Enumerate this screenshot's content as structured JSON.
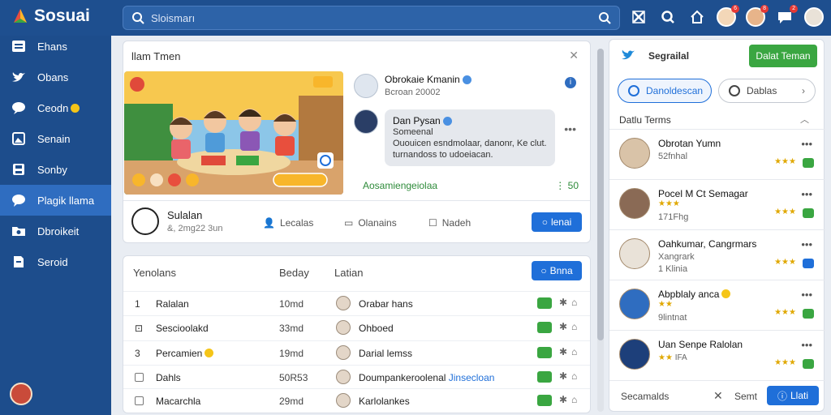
{
  "app": {
    "name": "Sosuai"
  },
  "search": {
    "placeholder": "Sloismarı"
  },
  "topbar": {
    "icons": [
      "tools-icon",
      "search-icon",
      "home-icon",
      "avatar-icon",
      "avatar-icon",
      "chat-icon",
      "avatar-icon"
    ],
    "badges": [
      "6",
      "8",
      "2"
    ]
  },
  "sidebar": {
    "items": [
      {
        "label": "Ehans",
        "icon": "list-icon"
      },
      {
        "label": "Obans",
        "icon": "bird-icon"
      },
      {
        "label": "Ceodn",
        "icon": "chat-icon"
      },
      {
        "label": "Senain",
        "icon": "image-icon"
      },
      {
        "label": "Sonby",
        "icon": "save-icon"
      },
      {
        "label": "Plagik llama",
        "icon": "chat-bubble-icon"
      },
      {
        "label": "Dbroikeit",
        "icon": "folder-icon"
      },
      {
        "label": "Seroid",
        "icon": "document-icon"
      }
    ]
  },
  "feed": {
    "title": "llam Tmen",
    "thread": [
      {
        "name": "Obrokaie Kmanin",
        "sub": "Bcroan 20002"
      },
      {
        "name": "Dan Pysan",
        "text": "Someenal\nOuouicen esndmolaar, danonr, Ke clut.\nturnandoss to udoeiacan."
      }
    ],
    "green_link": "Aosamiengeiolaa",
    "green_count": "50",
    "footer": {
      "name": "Sulalan",
      "sub": "&, 2mg22 3un",
      "actions": [
        "Lecalas",
        "Olanains",
        "Nadeh"
      ],
      "button": "lenai"
    }
  },
  "table": {
    "headers": [
      "Yenolans",
      "Beday",
      "Latian"
    ],
    "button": "Bnna",
    "rows": [
      {
        "idx": "1",
        "name": "Ralalan",
        "date": "10md",
        "person": "Orabar hans"
      },
      {
        "idx": "",
        "name": "Sescioolakd",
        "date": "33md",
        "person": "Ohboed"
      },
      {
        "idx": "3",
        "name": "Percamien",
        "date": "19md",
        "person": "Darial lemss"
      },
      {
        "idx": "",
        "name": "Dahls",
        "date": "50R53",
        "person": "Doumpankeroolenal",
        "link": "Jinsecloan"
      },
      {
        "idx": "",
        "name": "Macarchla",
        "date": "29md",
        "person": "Karlolankes"
      }
    ]
  },
  "right": {
    "title": "Segrailal",
    "green_button": "Dalat Teman",
    "pills": [
      "Danoldescan",
      "Dablas"
    ],
    "section": "Datlu Terms",
    "trends": [
      {
        "name": "Obrotan Yumn",
        "sub": "52fnhal",
        "stars": "",
        "rstars": "★★★",
        "tag": "#3aa641"
      },
      {
        "name": "Pocel M Ct Semagar",
        "sub": "171Fhg",
        "stars": "★★★",
        "rstars": "★★★",
        "tag": "#3aa641"
      },
      {
        "name": "Oahkumar, Cangrmars",
        "sub": "Xangrark",
        "sub2": "1 Klinia",
        "stars": "",
        "rstars": "★★★",
        "tag": "#1f6fd9"
      },
      {
        "name": "Abpblaly anca",
        "sub": "9lintnat",
        "stars": "★★",
        "rstars": "★★★",
        "tag": "#3aa641"
      },
      {
        "name": "Uan Senpe Ralolan",
        "sub": "IFA",
        "stars": "★★",
        "rstars": "★★★",
        "tag": "#3aa641"
      }
    ],
    "footer": {
      "left": "Secamalds",
      "middle": "Semt",
      "button": "Llati"
    }
  },
  "colors": {
    "topbar": "#1e4f8f",
    "sidebar": "#1d4d8c",
    "accent": "#1f6fd9",
    "green": "#3aa641"
  }
}
